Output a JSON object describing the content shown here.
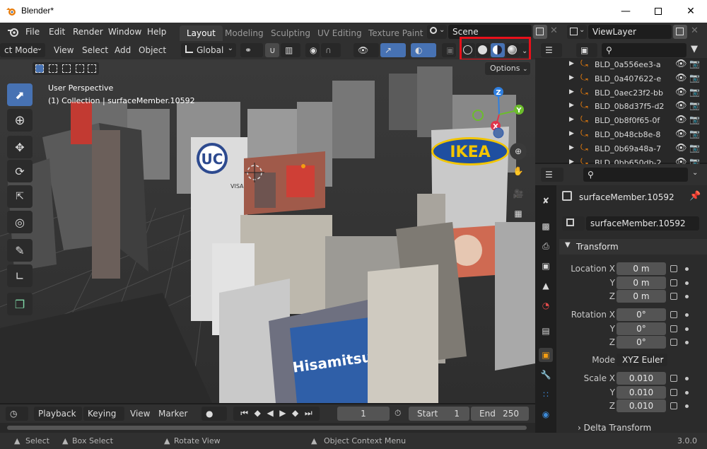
{
  "window": {
    "title": "Blender*",
    "min_icon": "minimize-icon",
    "max_icon": "maximize-icon",
    "close_icon": "close-icon"
  },
  "menu": {
    "items": [
      "File",
      "Edit",
      "Render",
      "Window",
      "Help"
    ]
  },
  "workspaces": {
    "tabs": [
      "Layout",
      "Modeling",
      "Sculpting",
      "UV Editing",
      "Texture Paint"
    ],
    "active": "Layout"
  },
  "scene": {
    "label": "Scene",
    "view_layer": "ViewLayer"
  },
  "viewport_header": {
    "mode": "ct Mode",
    "menus": [
      "View",
      "Select",
      "Add",
      "Object"
    ],
    "transform_orientation": "Global",
    "options_label": "Options"
  },
  "viewport": {
    "view_name": "User Perspective",
    "collection_info": "(1) Collection | surfaceMember.10592",
    "gizmo_axes": [
      "Z",
      "Y",
      "X"
    ],
    "highlight_color": "#e8101a",
    "signs": {
      "uc": "UC",
      "visa": "VISA",
      "ikea": "IKEA",
      "hisamitsu": "Hisamitsu"
    }
  },
  "outliner": {
    "items": [
      "BLD_0a556ee3-a",
      "BLD_0a407622-e",
      "BLD_0aec23f2-bb",
      "BLD_0b8d37f5-d2",
      "BLD_0b8f0f65-0f",
      "BLD_0b48cb8e-8",
      "BLD_0b69a48a-7",
      "BLD_0bb650db-2"
    ]
  },
  "properties": {
    "object_name": "surfaceMember.10592",
    "data_name": "surfaceMember.10592",
    "transform_label": "Transform",
    "location_label": "Location X",
    "location": [
      "0 m",
      "0 m",
      "0 m"
    ],
    "rotation_label": "Rotation X",
    "rotation": [
      "0°",
      "0°",
      "0°"
    ],
    "mode_label": "Mode",
    "mode_value": "XYZ Euler",
    "scale_label": "Scale X",
    "scale": [
      "0.010",
      "0.010",
      "0.010"
    ],
    "axis_y": "Y",
    "axis_z": "Z",
    "delta_label": "Delta Transform"
  },
  "timeline": {
    "menus": [
      "Playback",
      "Keying",
      "View",
      "Marker"
    ],
    "current_frame": "1",
    "start_label": "Start",
    "start": "1",
    "end_label": "End",
    "end": "250"
  },
  "statusbar": {
    "items": [
      "Select",
      "Box Select",
      "Rotate View",
      "Object Context Menu"
    ],
    "version": "3.0.0"
  }
}
